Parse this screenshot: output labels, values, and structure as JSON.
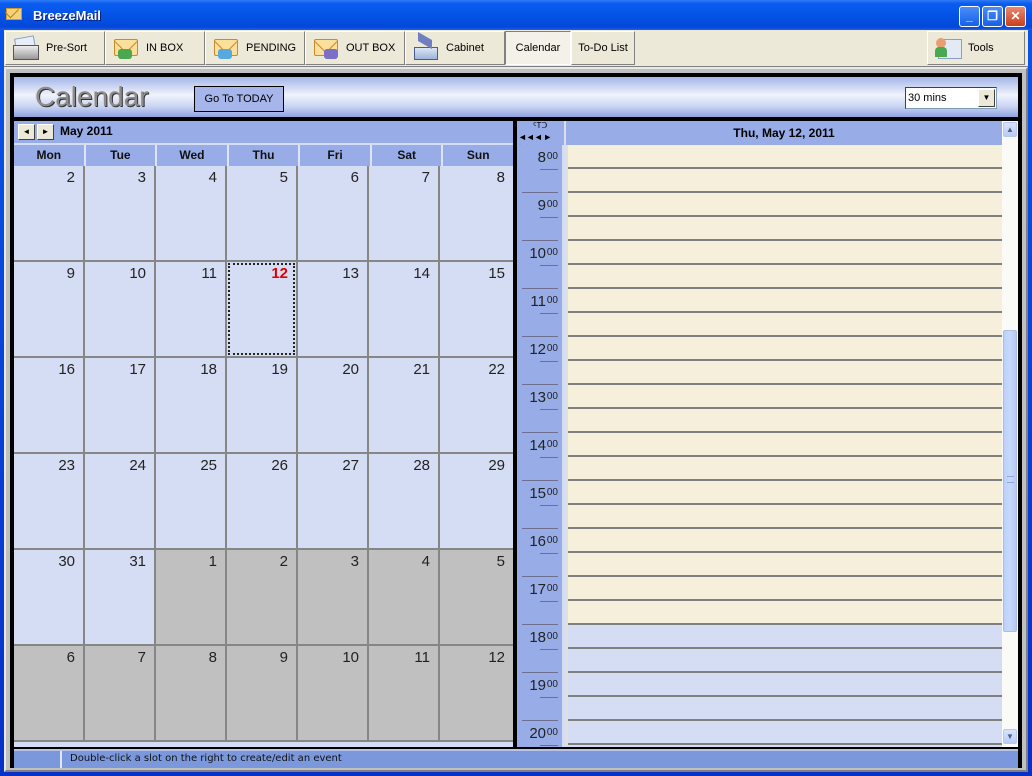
{
  "window": {
    "title": "BreezeMail",
    "controls": {
      "minimize": "_",
      "restore": "❐",
      "close": "✕"
    }
  },
  "toolbar": {
    "items": [
      {
        "label": "Pre-Sort",
        "icon": "presort-icon"
      },
      {
        "label": "IN BOX",
        "icon": "inbox-icon"
      },
      {
        "label": "PENDING",
        "icon": "pending-icon"
      },
      {
        "label": "OUT BOX",
        "icon": "outbox-icon"
      },
      {
        "label": "Cabinet",
        "icon": "cabinet-icon"
      },
      {
        "label": "Calendar",
        "active": true
      },
      {
        "label": "To-Do List"
      }
    ],
    "tools_label": "Tools"
  },
  "header": {
    "title": "Calendar",
    "goto_today": "Go To TODAY",
    "interval": "30 mins"
  },
  "month_view": {
    "label": "May 2011",
    "prev": "◄",
    "next": "►",
    "weekdays": [
      "Mon",
      "Tue",
      "Wed",
      "Thu",
      "Fri",
      "Sat",
      "Sun"
    ],
    "weeks": [
      [
        {
          "d": "2"
        },
        {
          "d": "3"
        },
        {
          "d": "4"
        },
        {
          "d": "5"
        },
        {
          "d": "6"
        },
        {
          "d": "7"
        },
        {
          "d": "8"
        }
      ],
      [
        {
          "d": "9"
        },
        {
          "d": "10"
        },
        {
          "d": "11"
        },
        {
          "d": "12",
          "today": true
        },
        {
          "d": "13"
        },
        {
          "d": "14"
        },
        {
          "d": "15"
        }
      ],
      [
        {
          "d": "16"
        },
        {
          "d": "17"
        },
        {
          "d": "18"
        },
        {
          "d": "19"
        },
        {
          "d": "20"
        },
        {
          "d": "21"
        },
        {
          "d": "22"
        }
      ],
      [
        {
          "d": "23"
        },
        {
          "d": "24"
        },
        {
          "d": "25"
        },
        {
          "d": "26"
        },
        {
          "d": "27"
        },
        {
          "d": "28"
        },
        {
          "d": "29"
        }
      ],
      [
        {
          "d": "30"
        },
        {
          "d": "31"
        },
        {
          "d": "1",
          "other": true
        },
        {
          "d": "2",
          "other": true
        },
        {
          "d": "3",
          "other": true
        },
        {
          "d": "4",
          "other": true
        },
        {
          "d": "5",
          "other": true
        }
      ],
      [
        {
          "d": "6",
          "other": true
        },
        {
          "d": "7",
          "other": true
        },
        {
          "d": "8",
          "other": true
        },
        {
          "d": "9",
          "other": true
        },
        {
          "d": "10",
          "other": true
        },
        {
          "d": "11",
          "other": true
        },
        {
          "d": "12",
          "other": true
        }
      ]
    ],
    "today_color": "#e00000"
  },
  "day_view": {
    "date": "Thu, May 12, 2011",
    "nav_top": "ᑦTᑐ",
    "nav_bottom": "◄◄◄ ► ►►",
    "hours": [
      "8",
      "9",
      "10",
      "11",
      "12",
      "13",
      "14",
      "15",
      "16",
      "17",
      "18",
      "19",
      "20"
    ],
    "minutes_label": "00",
    "work_end_hour": 18
  },
  "status": {
    "text": "Double-click a slot on the right to create/edit an event"
  }
}
